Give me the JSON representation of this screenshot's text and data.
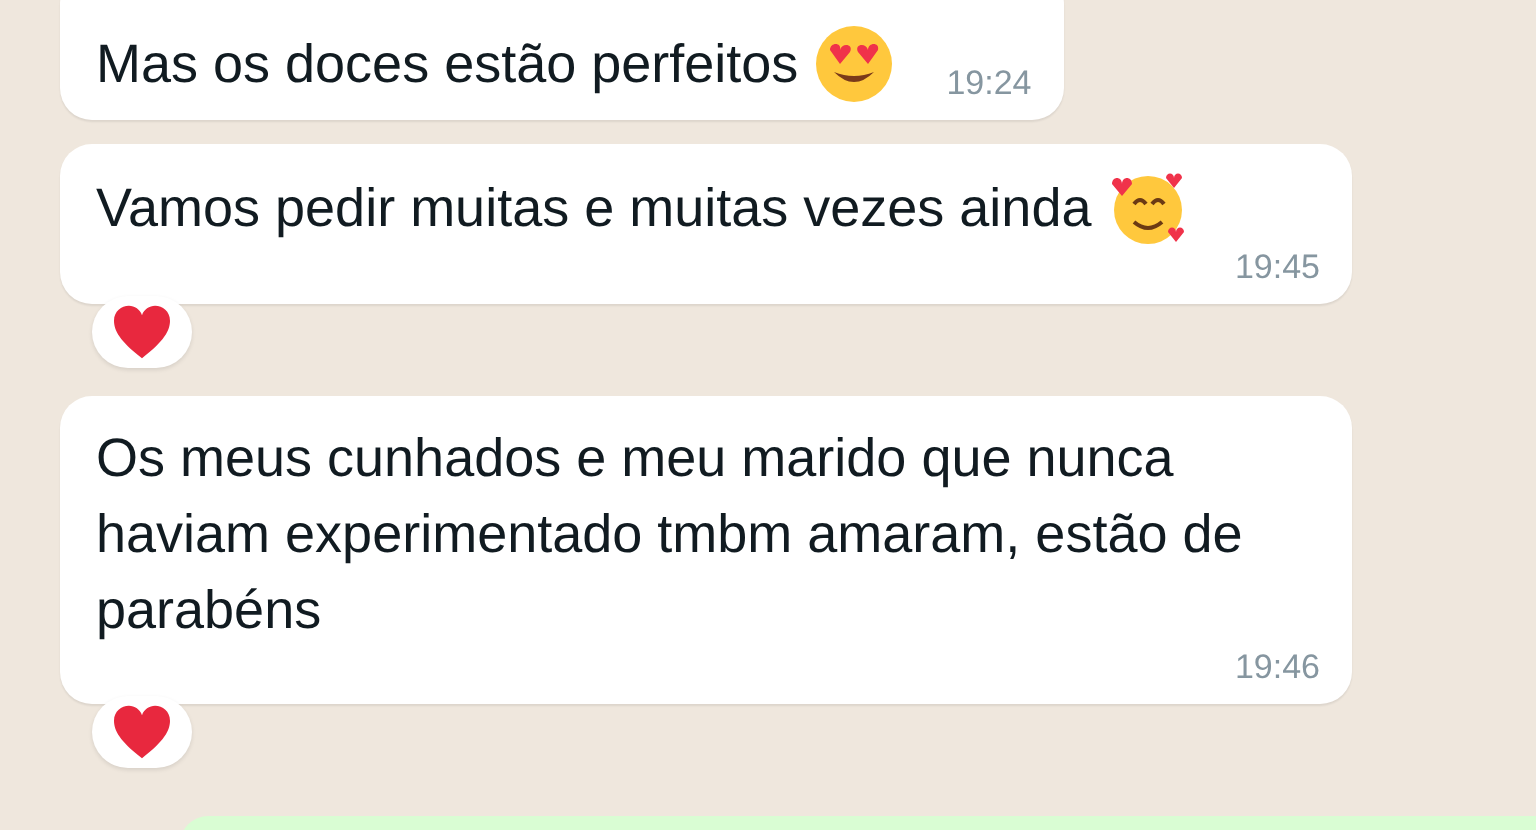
{
  "messages": [
    {
      "text": "Mas os doces estão perfeitos",
      "kind": "hearteyes",
      "time": "19:24",
      "reacted": false
    },
    {
      "text": "Vamos pedir muitas e muitas vezes ainda",
      "kind": "heartsface",
      "time": "19:45",
      "reacted": true
    },
    {
      "text": "Os meus cunhados e meu marido que nunca haviam experimentado tmbm amaram, estão de parabéns",
      "kind": "plain",
      "time": "19:46",
      "reacted": true
    }
  ]
}
